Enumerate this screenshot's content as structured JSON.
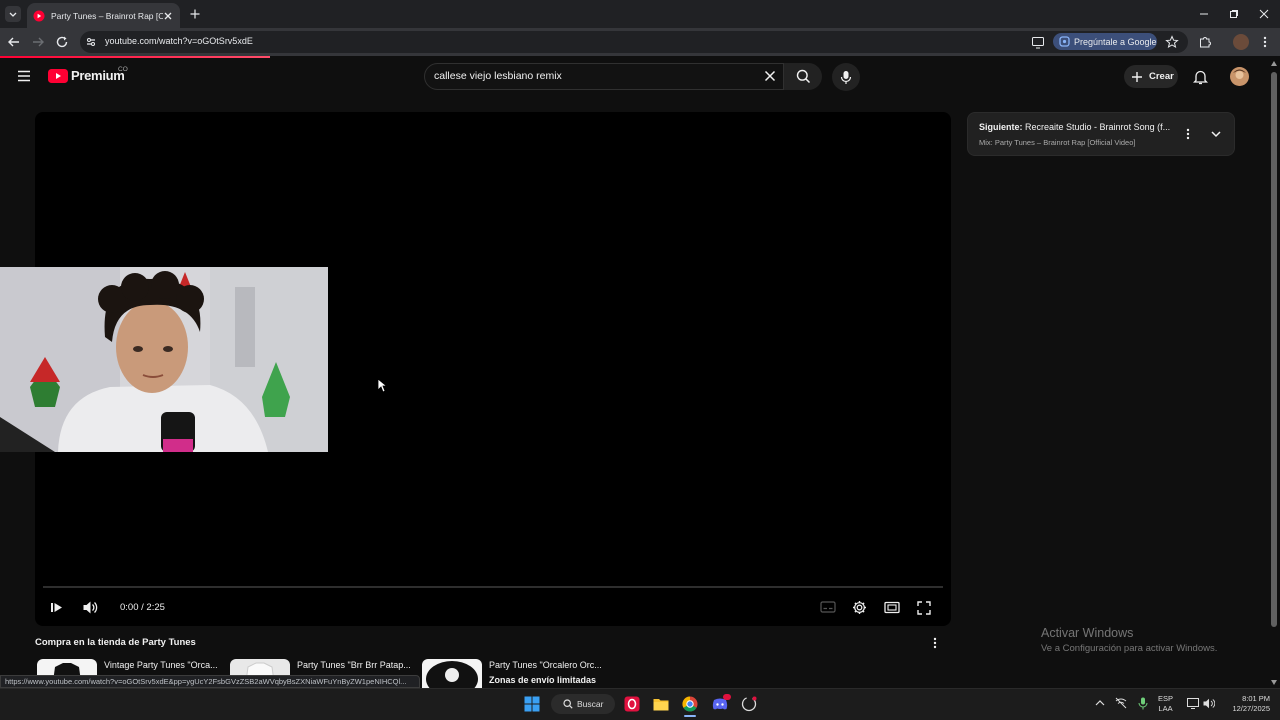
{
  "browser": {
    "tab_title": "Party Tunes – Brainrot Rap [Offi",
    "url": "youtube.com/watch?v=oGOtSrv5xdE",
    "gemini_label": "Pregúntale a Google",
    "status_url": "https://www.youtube.com/watch?v=oGOtSrv5xdE&pp=ygUcY2FsbGVzZSB2aWVqbyBsZXNiaWFuYnByZW1peNIHCQl..."
  },
  "youtube": {
    "logo_text": "Premium",
    "country_code": "CO",
    "search_query": "callese viejo lesbiano remix",
    "create_label": "Crear"
  },
  "player": {
    "time": "0:00 / 2:25",
    "progress": 0
  },
  "upnext": {
    "prefix": "Siguiente:",
    "title": " Recreaite Studio - Brainrot Song (f...",
    "subtitle": "Mix: Party Tunes – Brainrot Rap [Official Video]"
  },
  "shop": {
    "heading": "Compra en la tienda de Party Tunes",
    "items": [
      {
        "title": "Vintage Party Tunes \"Orca..."
      },
      {
        "title": "Party Tunes \"Brr Brr Patap..."
      },
      {
        "title": "Party Tunes \"Orcalero Orc...",
        "subtitle": "Zonas de envío limitadas"
      }
    ]
  },
  "watermark": {
    "line1": "Activar Windows",
    "line2": "Ve a Configuración para activar Windows."
  },
  "taskbar": {
    "search_label": "Buscar",
    "lang_top": "ESP",
    "lang_bottom": "LAA",
    "time": "8:01 PM",
    "date": "12/27/2025"
  },
  "colors": {
    "accent": "#ff0033",
    "background": "#0f0f0f"
  },
  "icons": [
    "menu-icon",
    "youtube-logo-icon",
    "close-icon",
    "search-icon",
    "mic-icon",
    "plus-icon",
    "bell-icon",
    "play-icon",
    "volume-icon",
    "captions-icon",
    "gear-icon",
    "theater-icon",
    "fullscreen-icon",
    "more-vert-icon",
    "chevron-down-icon",
    "windows-start-icon"
  ]
}
